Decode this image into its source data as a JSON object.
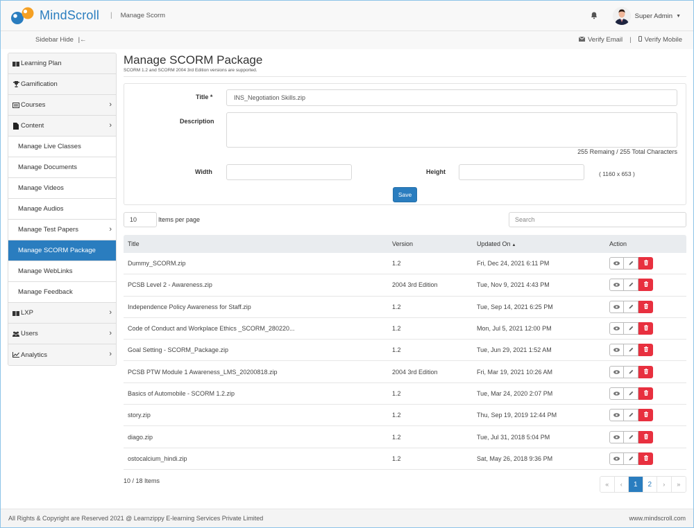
{
  "header": {
    "brand": "MindScroll",
    "separator": "|",
    "page_name": "Manage Scorm",
    "user_name": "Super Admin",
    "colors": {
      "brand_blue": "#2a7dbf",
      "brand_orange": "#f5a023"
    }
  },
  "subbar": {
    "sidebar_hide": "Sidebar Hide",
    "sidebar_hide_icon": "collapse-arrow-icon",
    "verify_email": "Verify Email",
    "verify_mobile": "Verify Mobile",
    "divider": "|"
  },
  "sidebar": {
    "items": [
      {
        "label": "Learning Plan",
        "icon": "book-icon",
        "submenu": false
      },
      {
        "label": "Gamification",
        "icon": "trophy-icon",
        "submenu": false
      },
      {
        "label": "Courses",
        "icon": "list-icon",
        "submenu": true
      },
      {
        "label": "Content",
        "icon": "file-icon",
        "submenu": true
      },
      {
        "label": "Manage Live Classes",
        "sub": true
      },
      {
        "label": "Manage Documents",
        "sub": true
      },
      {
        "label": "Manage Videos",
        "sub": true
      },
      {
        "label": "Manage Audios",
        "sub": true
      },
      {
        "label": "Manage Test Papers",
        "sub": true,
        "submenu": true
      },
      {
        "label": "Manage SCORM Package",
        "sub": true,
        "active": true
      },
      {
        "label": "Manage WebLinks",
        "sub": true
      },
      {
        "label": "Manage Feedback",
        "sub": true
      },
      {
        "label": "LXP",
        "icon": "book-icon",
        "submenu": true
      },
      {
        "label": "Users",
        "icon": "users-icon",
        "submenu": true
      },
      {
        "label": "Analytics",
        "icon": "chart-icon",
        "submenu": true
      }
    ]
  },
  "main": {
    "title": "Manage SCORM Package",
    "subtitle": "SCORM 1.2 and SCORM 2004 3rd Edition versions are supported.",
    "form": {
      "title_label": "Title *",
      "title_value": "INS_Negotiation Skills.zip",
      "description_label": "Description",
      "description_value": "",
      "char_counter": "255 Remaing / 255 Total Characters",
      "width_label": "Width",
      "width_value": "",
      "height_label": "Height",
      "height_value": "",
      "dimensions_hint": "( 1160 x 653 )",
      "save_label": "Save"
    },
    "list": {
      "per_page_value": "10",
      "per_page_label": "Items per page",
      "search_placeholder": "Search",
      "columns": [
        "Title",
        "Version",
        "Updated On",
        "Action"
      ],
      "sort_indicator": "▲",
      "rows": [
        {
          "title": "Dummy_SCORM.zip",
          "version": "1.2",
          "updated": "Fri, Dec 24, 2021 6:11 PM"
        },
        {
          "title": "PCSB Level 2 - Awareness.zip",
          "version": "2004 3rd Edition",
          "updated": "Tue, Nov 9, 2021 4:43 PM"
        },
        {
          "title": "Independence Policy Awareness for Staff.zip",
          "version": "1.2",
          "updated": "Tue, Sep 14, 2021 6:25 PM"
        },
        {
          "title": "Code of Conduct and Workplace Ethics _SCORM_280220...",
          "version": "1.2",
          "updated": "Mon, Jul 5, 2021 12:00 PM"
        },
        {
          "title": "Goal Setting - SCORM_Package.zip",
          "version": "1.2",
          "updated": "Tue, Jun 29, 2021 1:52 AM"
        },
        {
          "title": "PCSB PTW Module 1 Awareness_LMS_20200818.zip",
          "version": "2004 3rd Edition",
          "updated": "Fri, Mar 19, 2021 10:26 AM"
        },
        {
          "title": "Basics of Automobile - SCORM 1.2.zip",
          "version": "1.2",
          "updated": "Tue, Mar 24, 2020 2:07 PM"
        },
        {
          "title": "story.zip",
          "version": "1.2",
          "updated": "Thu, Sep 19, 2019 12:44 PM"
        },
        {
          "title": "diago.zip",
          "version": "1.2",
          "updated": "Tue, Jul 31, 2018 5:04 PM"
        },
        {
          "title": "ostocalcium_hindi.zip",
          "version": "1.2",
          "updated": "Sat, May 26, 2018 9:36 PM"
        }
      ],
      "actions": [
        "view-icon",
        "edit-icon",
        "delete-icon"
      ],
      "items_count": "10 / 18 Items",
      "pagination": {
        "first": "«",
        "prev": "‹",
        "pages": [
          "1",
          "2"
        ],
        "current": "1",
        "next": "›",
        "last": "»"
      }
    }
  },
  "footer": {
    "copyright": "All Rights & Copyright are Reserved 2021 @ Learnzippy E-learning Services Private Limited",
    "website": "www.mindscroll.com"
  }
}
